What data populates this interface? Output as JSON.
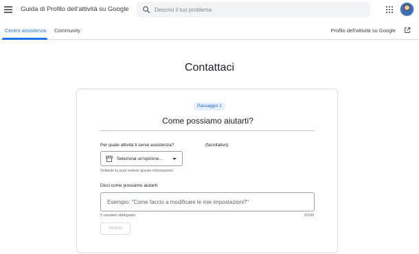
{
  "header": {
    "title": "Guida di Profilo dell'attività su Google",
    "search_placeholder": "Descrivi il tuo problema",
    "menu_icon": "hamburger-menu-icon",
    "apps_icon": "apps-grid-icon",
    "avatar_icon": "user-avatar"
  },
  "tabs": {
    "items": [
      {
        "label": "Centro assistenza",
        "active": true
      },
      {
        "label": "Community",
        "active": false
      }
    ],
    "profile_link": "Profilo dell'attività su Google",
    "profile_link_icon": "open-in-new-icon"
  },
  "main": {
    "title": "Contattaci"
  },
  "form": {
    "step_badge": "Passaggio 1",
    "heading": "Come possiamo aiutarti?",
    "business_question": "Per quale attività ti serve assistenza?",
    "optional_label": "(facoltativo)",
    "select_value": "Seleziona un'opzione...",
    "select_icon": "storefront-icon",
    "select_helper": "Soltanto tu puoi vedere queste informazioni",
    "describe_label": "Dicci come possiamo aiutarti:",
    "describe_placeholder": "Esempio: \"Come faccio a modificare le mie impostazioni?\"",
    "required_chars": "5 caratteri obbligatori",
    "char_counter": "0/100",
    "next_button": "Avanti"
  },
  "colors": {
    "accent": "#1a73e8",
    "badge_bg": "#e8f0fe",
    "border": "#dadce0",
    "disabled_text": "#bdc1c6"
  }
}
